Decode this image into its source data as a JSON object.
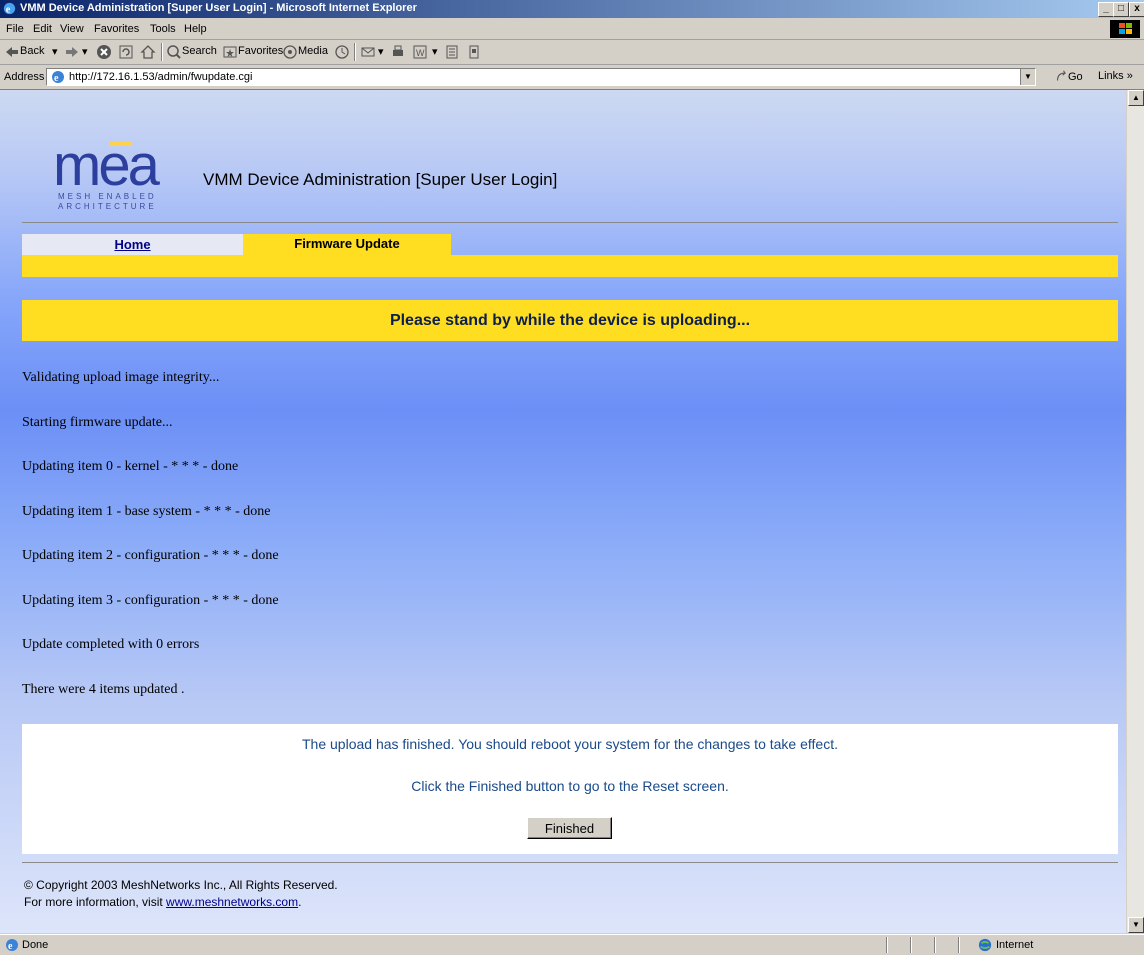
{
  "window": {
    "title": "VMM Device Administration [Super User Login] - Microsoft Internet Explorer",
    "minimize": "_",
    "maximize": "□",
    "close": "x"
  },
  "menu": [
    "File",
    "Edit",
    "View",
    "Favorites",
    "Tools",
    "Help"
  ],
  "toolbar": {
    "back": "Back",
    "search": "Search",
    "favorites": "Favorites",
    "media": "Media"
  },
  "address": {
    "label": "Address",
    "url": "http://172.16.1.53/admin/fwupdate.cgi",
    "go": "Go",
    "links": "Links »"
  },
  "page": {
    "logo_text": "mea",
    "logo_tag1": "MESH ENABLED",
    "logo_tag2": "ARCHITECTURE",
    "title": "VMM Device Administration [Super User Login]",
    "nav_home": "Home",
    "nav_fw": "Firmware Update",
    "banner": "Please stand by while the device is uploading...",
    "log": [
      "Validating upload image integrity...",
      "Starting firmware update...",
      "Updating item 0 - kernel - * * * - done",
      "Updating item 1 - base system - * * * - done",
      "Updating item 2 - configuration - * * * - done",
      "Updating item 3 - configuration - * * * - done",
      "Update completed with 0 errors",
      "There were 4 items updated ."
    ],
    "finish_msg1": "The upload has finished. You should reboot your system for the changes to take effect.",
    "finish_msg2": "Click the Finished button to go to the Reset screen.",
    "finished_button": "Finished",
    "copyright": "© Copyright 2003 MeshNetworks Inc., All Rights Reserved.",
    "more_prefix": "For more information, visit ",
    "more_link": "www.meshnetworks.com",
    "more_suffix": "."
  },
  "statusbar": {
    "status": "Done",
    "zone": "Internet"
  },
  "icons": [
    "ie-app-icon",
    "back-arrow-icon",
    "forward-arrow-icon",
    "stop-icon",
    "refresh-icon",
    "home-icon",
    "search-icon",
    "favorites-icon",
    "media-icon",
    "history-icon",
    "mail-icon",
    "print-icon",
    "edit-icon",
    "discuss-icon",
    "messenger-icon",
    "page-icon",
    "go-arrow-icon",
    "globe-icon",
    "windows-logo-icon"
  ]
}
